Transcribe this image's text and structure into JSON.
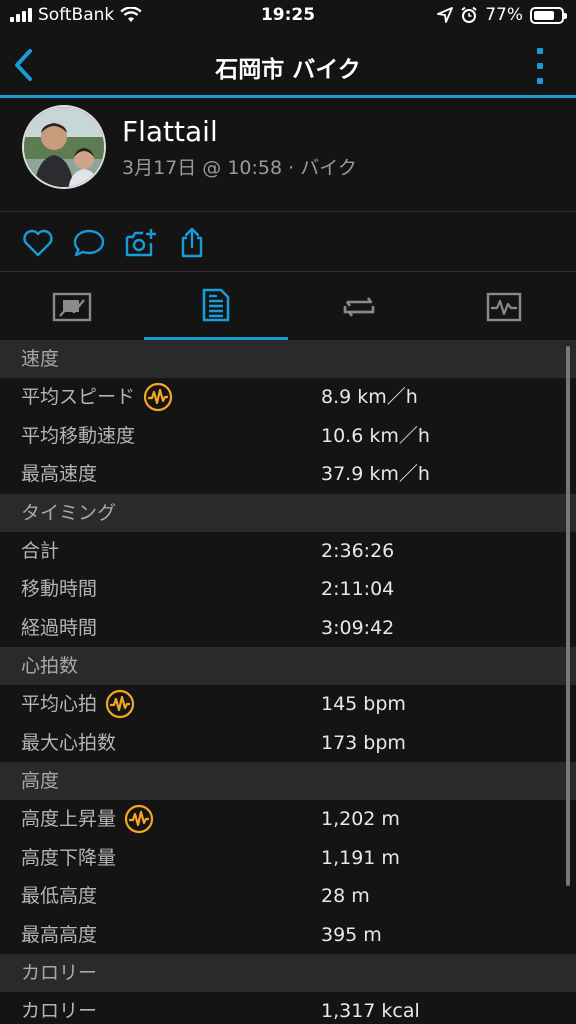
{
  "status": {
    "carrier": "SoftBank",
    "time": "19:25",
    "battery": "77%",
    "battery_level": 0.77
  },
  "nav": {
    "title": "石岡市 バイク"
  },
  "profile": {
    "name": "Flattail",
    "meta": "3月17日 @ 10:58 · バイク"
  },
  "colors": {
    "accent": "#1a9ad6",
    "hr_icon": "#f5a623",
    "background": "#141414",
    "section_bg": "#2a2a2a"
  },
  "sections": {
    "speed": {
      "title": "速度",
      "rows": [
        {
          "label": "平均スピード",
          "value": "8.9 km／h"
        },
        {
          "label": "平均移動速度",
          "value": "10.6 km／h"
        },
        {
          "label": "最高速度",
          "value": "37.9 km／h"
        }
      ]
    },
    "timing": {
      "title": "タイミング",
      "rows": [
        {
          "label": "合計",
          "value": "2:36:26"
        },
        {
          "label": "移動時間",
          "value": "2:11:04"
        },
        {
          "label": "経過時間",
          "value": "3:09:42"
        }
      ]
    },
    "heart": {
      "title": "心拍数",
      "rows": [
        {
          "label": "平均心拍",
          "value": "145 bpm"
        },
        {
          "label": "最大心拍数",
          "value": "173 bpm"
        }
      ]
    },
    "elevation": {
      "title": "高度",
      "rows": [
        {
          "label": "高度上昇量",
          "value": "1,202 m"
        },
        {
          "label": "高度下降量",
          "value": "1,191 m"
        },
        {
          "label": "最低高度",
          "value": "28 m"
        },
        {
          "label": "最高高度",
          "value": "395 m"
        }
      ]
    },
    "calories": {
      "title": "カロリー",
      "rows": [
        {
          "label": "カロリー",
          "value": "1,317 kcal"
        }
      ]
    }
  }
}
